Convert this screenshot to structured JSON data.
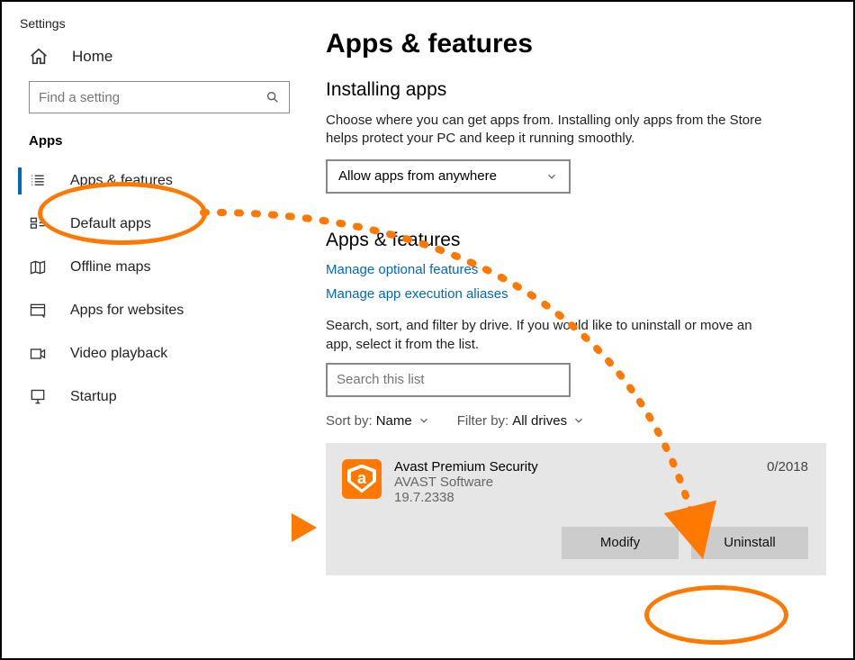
{
  "window": {
    "title": "Settings"
  },
  "sidebar": {
    "home_label": "Home",
    "search_placeholder": "Find a setting",
    "section_head": "Apps",
    "items": [
      {
        "label": "Apps & features",
        "selected": true
      },
      {
        "label": "Default apps"
      },
      {
        "label": "Offline maps"
      },
      {
        "label": "Apps for websites"
      },
      {
        "label": "Video playback"
      },
      {
        "label": "Startup"
      }
    ]
  },
  "main": {
    "page_title": "Apps & features",
    "install_head": "Installing apps",
    "install_desc": "Choose where you can get apps from. Installing only apps from the Store helps protect your PC and keep it running smoothly.",
    "install_select_value": "Allow apps from anywhere",
    "section2_head": "Apps & features",
    "link_optional": "Manage optional features",
    "link_aliases": "Manage app execution aliases",
    "listdesc": "Search, sort, and filter by drive. If you would like to uninstall or move an app, select it from the list.",
    "list_search_placeholder": "Search this list",
    "sort_label": "Sort by:",
    "sort_value": "Name",
    "filter_label": "Filter by:",
    "filter_value": "All drives",
    "app": {
      "name": "Avast Premium Security",
      "publisher": "AVAST Software",
      "version": "19.7.2338",
      "date": "0/2018",
      "modify": "Modify",
      "uninstall": "Uninstall"
    }
  }
}
